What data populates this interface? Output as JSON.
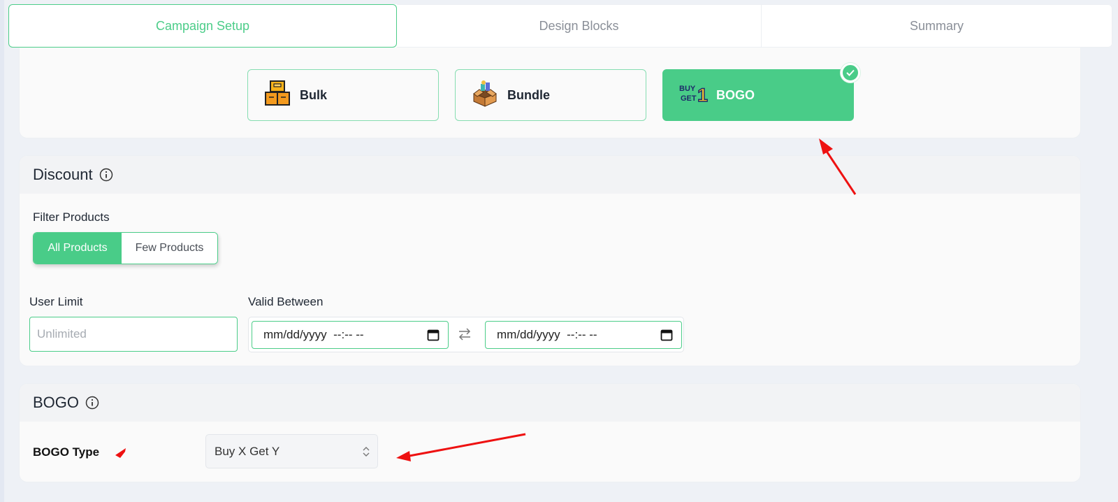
{
  "tabs": [
    {
      "label": "Campaign Setup"
    },
    {
      "label": "Design Blocks"
    },
    {
      "label": "Summary"
    }
  ],
  "campaign_types": [
    {
      "label": "Bulk"
    },
    {
      "label": "Bundle"
    },
    {
      "label": "BOGO",
      "logo_text_top": "BUY",
      "logo_text_bottom": "GET",
      "logo_number": "1"
    }
  ],
  "discount": {
    "title": "Discount",
    "filter_label": "Filter Products",
    "filter_options": [
      "All Products",
      "Few Products"
    ],
    "user_limit_label": "User Limit",
    "user_limit_placeholder": "Unlimited",
    "valid_between_label": "Valid Between",
    "start_date": "mm/dd/yyyy  --:-- --",
    "end_date": "mm/dd/yyyy  --:-- --"
  },
  "bogo": {
    "title": "BOGO",
    "type_label": "BOGO Type",
    "type_value": "Buy X Get Y"
  },
  "colors": {
    "accent": "#49cc88",
    "annotation_arrow": "#ee1111"
  }
}
